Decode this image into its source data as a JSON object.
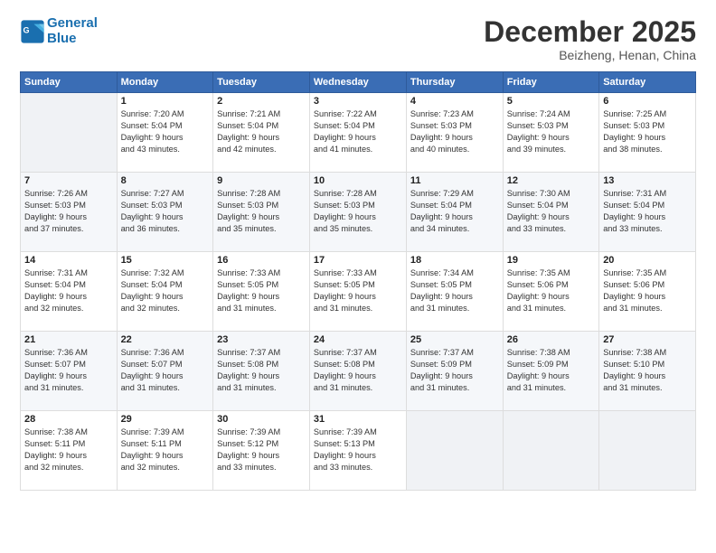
{
  "header": {
    "logo_line1": "General",
    "logo_line2": "Blue",
    "month": "December 2025",
    "location": "Beizheng, Henan, China"
  },
  "weekdays": [
    "Sunday",
    "Monday",
    "Tuesday",
    "Wednesday",
    "Thursday",
    "Friday",
    "Saturday"
  ],
  "weeks": [
    [
      {
        "day": "",
        "info": ""
      },
      {
        "day": "1",
        "info": "Sunrise: 7:20 AM\nSunset: 5:04 PM\nDaylight: 9 hours\nand 43 minutes."
      },
      {
        "day": "2",
        "info": "Sunrise: 7:21 AM\nSunset: 5:04 PM\nDaylight: 9 hours\nand 42 minutes."
      },
      {
        "day": "3",
        "info": "Sunrise: 7:22 AM\nSunset: 5:04 PM\nDaylight: 9 hours\nand 41 minutes."
      },
      {
        "day": "4",
        "info": "Sunrise: 7:23 AM\nSunset: 5:03 PM\nDaylight: 9 hours\nand 40 minutes."
      },
      {
        "day": "5",
        "info": "Sunrise: 7:24 AM\nSunset: 5:03 PM\nDaylight: 9 hours\nand 39 minutes."
      },
      {
        "day": "6",
        "info": "Sunrise: 7:25 AM\nSunset: 5:03 PM\nDaylight: 9 hours\nand 38 minutes."
      }
    ],
    [
      {
        "day": "7",
        "info": "Sunrise: 7:26 AM\nSunset: 5:03 PM\nDaylight: 9 hours\nand 37 minutes."
      },
      {
        "day": "8",
        "info": "Sunrise: 7:27 AM\nSunset: 5:03 PM\nDaylight: 9 hours\nand 36 minutes."
      },
      {
        "day": "9",
        "info": "Sunrise: 7:28 AM\nSunset: 5:03 PM\nDaylight: 9 hours\nand 35 minutes."
      },
      {
        "day": "10",
        "info": "Sunrise: 7:28 AM\nSunset: 5:03 PM\nDaylight: 9 hours\nand 35 minutes."
      },
      {
        "day": "11",
        "info": "Sunrise: 7:29 AM\nSunset: 5:04 PM\nDaylight: 9 hours\nand 34 minutes."
      },
      {
        "day": "12",
        "info": "Sunrise: 7:30 AM\nSunset: 5:04 PM\nDaylight: 9 hours\nand 33 minutes."
      },
      {
        "day": "13",
        "info": "Sunrise: 7:31 AM\nSunset: 5:04 PM\nDaylight: 9 hours\nand 33 minutes."
      }
    ],
    [
      {
        "day": "14",
        "info": "Sunrise: 7:31 AM\nSunset: 5:04 PM\nDaylight: 9 hours\nand 32 minutes."
      },
      {
        "day": "15",
        "info": "Sunrise: 7:32 AM\nSunset: 5:04 PM\nDaylight: 9 hours\nand 32 minutes."
      },
      {
        "day": "16",
        "info": "Sunrise: 7:33 AM\nSunset: 5:05 PM\nDaylight: 9 hours\nand 31 minutes."
      },
      {
        "day": "17",
        "info": "Sunrise: 7:33 AM\nSunset: 5:05 PM\nDaylight: 9 hours\nand 31 minutes."
      },
      {
        "day": "18",
        "info": "Sunrise: 7:34 AM\nSunset: 5:05 PM\nDaylight: 9 hours\nand 31 minutes."
      },
      {
        "day": "19",
        "info": "Sunrise: 7:35 AM\nSunset: 5:06 PM\nDaylight: 9 hours\nand 31 minutes."
      },
      {
        "day": "20",
        "info": "Sunrise: 7:35 AM\nSunset: 5:06 PM\nDaylight: 9 hours\nand 31 minutes."
      }
    ],
    [
      {
        "day": "21",
        "info": "Sunrise: 7:36 AM\nSunset: 5:07 PM\nDaylight: 9 hours\nand 31 minutes."
      },
      {
        "day": "22",
        "info": "Sunrise: 7:36 AM\nSunset: 5:07 PM\nDaylight: 9 hours\nand 31 minutes."
      },
      {
        "day": "23",
        "info": "Sunrise: 7:37 AM\nSunset: 5:08 PM\nDaylight: 9 hours\nand 31 minutes."
      },
      {
        "day": "24",
        "info": "Sunrise: 7:37 AM\nSunset: 5:08 PM\nDaylight: 9 hours\nand 31 minutes."
      },
      {
        "day": "25",
        "info": "Sunrise: 7:37 AM\nSunset: 5:09 PM\nDaylight: 9 hours\nand 31 minutes."
      },
      {
        "day": "26",
        "info": "Sunrise: 7:38 AM\nSunset: 5:09 PM\nDaylight: 9 hours\nand 31 minutes."
      },
      {
        "day": "27",
        "info": "Sunrise: 7:38 AM\nSunset: 5:10 PM\nDaylight: 9 hours\nand 31 minutes."
      }
    ],
    [
      {
        "day": "28",
        "info": "Sunrise: 7:38 AM\nSunset: 5:11 PM\nDaylight: 9 hours\nand 32 minutes."
      },
      {
        "day": "29",
        "info": "Sunrise: 7:39 AM\nSunset: 5:11 PM\nDaylight: 9 hours\nand 32 minutes."
      },
      {
        "day": "30",
        "info": "Sunrise: 7:39 AM\nSunset: 5:12 PM\nDaylight: 9 hours\nand 33 minutes."
      },
      {
        "day": "31",
        "info": "Sunrise: 7:39 AM\nSunset: 5:13 PM\nDaylight: 9 hours\nand 33 minutes."
      },
      {
        "day": "",
        "info": ""
      },
      {
        "day": "",
        "info": ""
      },
      {
        "day": "",
        "info": ""
      }
    ]
  ]
}
